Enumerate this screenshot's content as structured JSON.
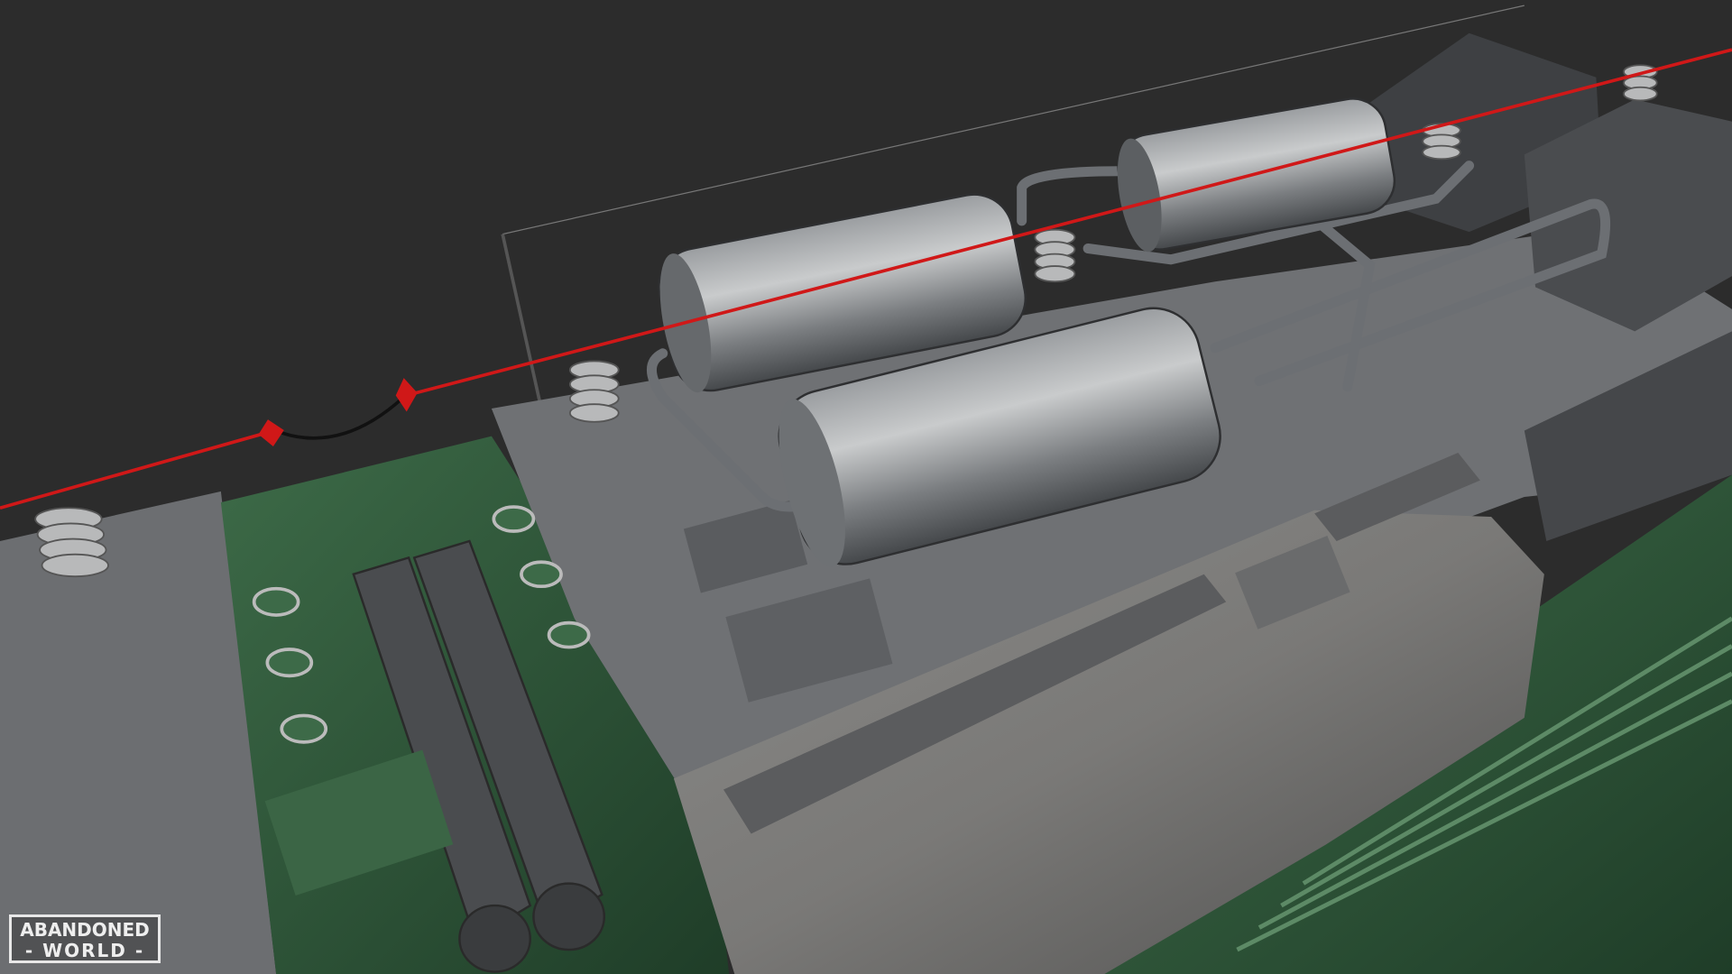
{
  "logo": {
    "line1": "ABANDONED",
    "line2": "WORLD"
  },
  "colors": {
    "background": "#2c2c2c",
    "roof": "#6f7174",
    "hood": "#7d7d7b",
    "body_green": "#2f5a3a",
    "wire": "#d01818"
  }
}
